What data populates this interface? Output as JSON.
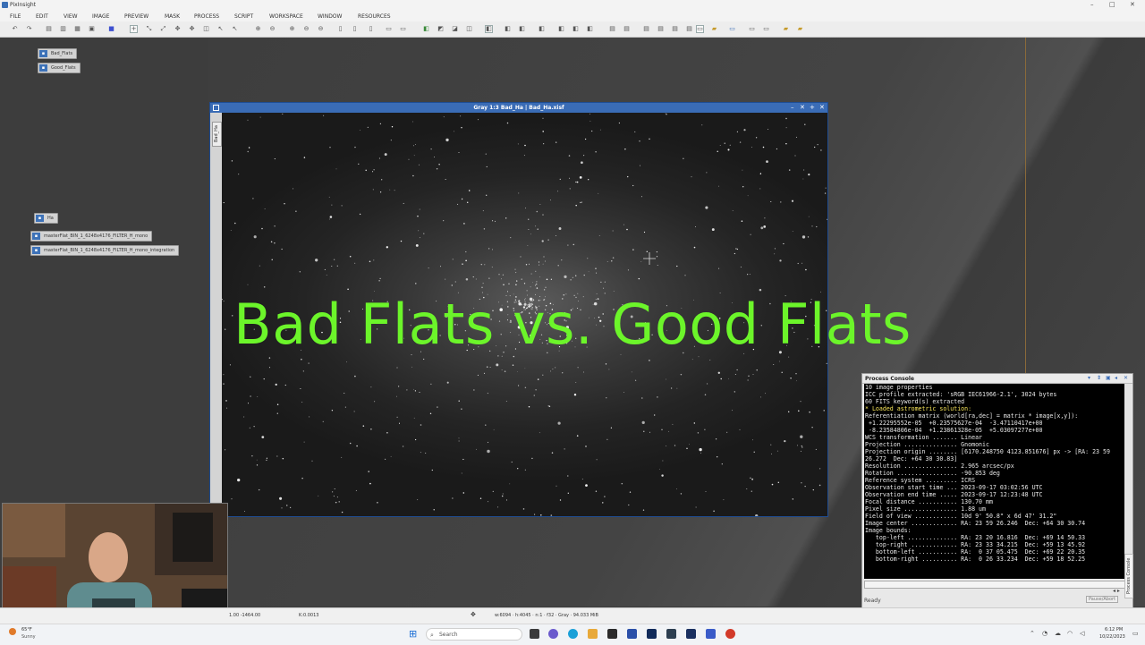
{
  "window": {
    "title": "PixInsight"
  },
  "menu": [
    "FILE",
    "EDIT",
    "VIEW",
    "IMAGE",
    "PREVIEW",
    "MASK",
    "PROCESS",
    "SCRIPT",
    "WORKSPACE",
    "WINDOW",
    "RESOURCES"
  ],
  "desktop_icons": {
    "top": [
      "Bad_Flats",
      "Good_Flats"
    ],
    "mid": [
      "Ha",
      "masterFlat_BIN_1_6248x4176_FILTER_H_mono",
      "masterFlat_BIN_1_6248x4176_FILTER_H_mono_integration"
    ]
  },
  "image_window": {
    "title": "Gray 1:3 Bad_Ha | Bad_Ha.xisf",
    "side_tab": "Bad_Ha"
  },
  "overlay_title": "Bad Flats vs. Good Flats",
  "console": {
    "title": "Process Console",
    "lines": [
      "10 image properties",
      "ICC profile extracted: 'sRGB IEC61966-2.1', 3024 bytes",
      "60 FITS keyword(s) extracted",
      "* Loaded astrometric solution:",
      "Referentiation matrix (world[ra,dec] = matrix * image[x,y]):",
      " +1.22295552e-05  +0.23575627e-04  -3.47110417e+00",
      " -8.23584806e-04  +1.23861328e-05  +5.03097277e+00",
      "WCS transformation ....... Linear",
      "Projection ............... Gnomonic",
      "Projection origin ........ [6170.248750 4123.851676] px -> [RA: 23 59",
      "26.272  Dec: +64 30 30.83]",
      "Resolution ............... 2.965 arcsec/px",
      "Rotation ................. -90.853 deg",
      "Reference system ......... ICRS",
      "Observation start time ... 2023-09-17 03:02:56 UTC",
      "Observation end time ..... 2023-09-17 12:23:48 UTC",
      "Focal distance ........... 130.70 mm",
      "Pixel size ............... 1.88 um",
      "Field of view ............ 10d 9' 50.8\" x 6d 47' 31.2\"",
      "Image center ............. RA: 23 59 26.246  Dec: +64 30 30.74",
      "Image bounds:",
      "   top-left .............. RA: 23 20 16.816  Dec: +69 14 50.33",
      "   top-right ............. RA: 23 33 34.215  Dec: +59 13 45.92",
      "   bottom-left ........... RA:  0 37 05.475  Dec: +69 22 20.35",
      "   bottom-right .......... RA:  0 26 33.234  Dec: +59 18 52.25"
    ],
    "status": "Ready",
    "abort": "Pause/Abort",
    "side_tab": "Process Console"
  },
  "status_bar": {
    "coords": "1.00    -1464.00",
    "k": "K:0.0013",
    "info": "w:6094 · h:4045 · n:1 · f32 · Gray · 94.033 MiB"
  },
  "taskbar": {
    "weather_temp": "65°F",
    "weather_desc": "Sunny",
    "search_placeholder": "Search",
    "time": "6:12 PM",
    "date": "10/22/2023"
  },
  "colors": {
    "accent": "#3a6cb6",
    "title_green": "#6cf52a"
  }
}
